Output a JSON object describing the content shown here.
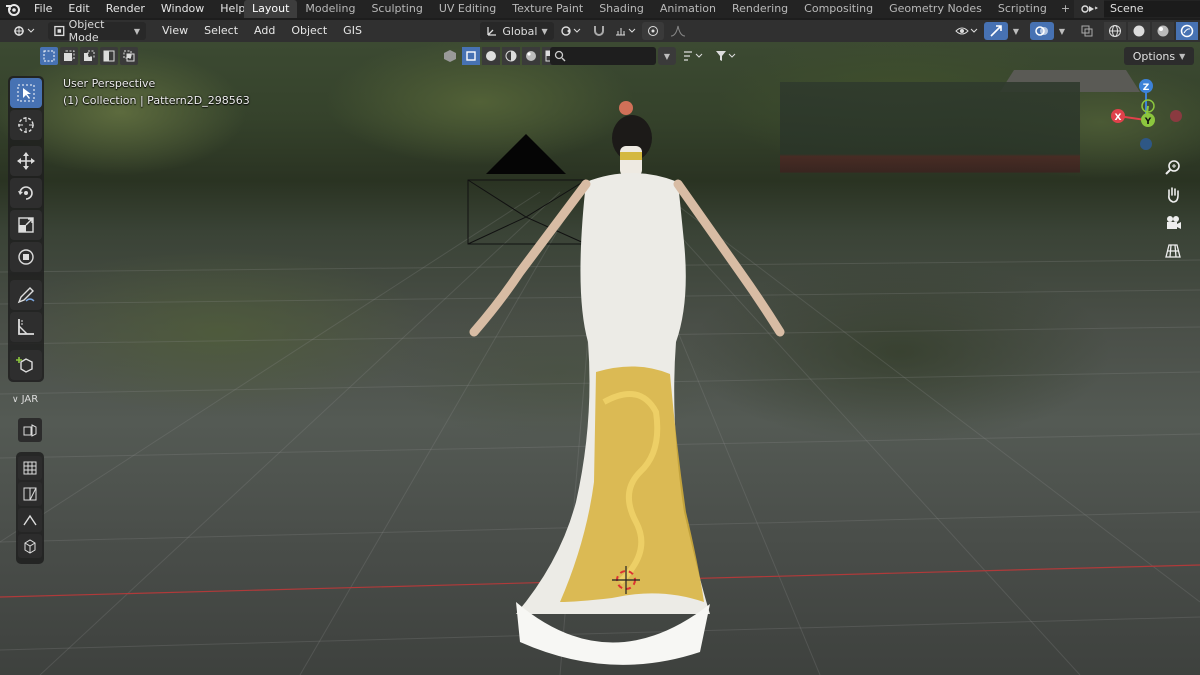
{
  "topbar": {
    "menus": [
      "File",
      "Edit",
      "Render",
      "Window",
      "Help"
    ],
    "workspaces": [
      "Layout",
      "Modeling",
      "Sculpting",
      "UV Editing",
      "Texture Paint",
      "Shading",
      "Animation",
      "Rendering",
      "Compositing",
      "Geometry Nodes",
      "Scripting"
    ],
    "active_workspace": "Layout",
    "add_symbol": "+",
    "scene_name": "Scene"
  },
  "viewport_header": {
    "mode": "Object Mode",
    "menus": [
      "View",
      "Select",
      "Add",
      "Object",
      "GIS"
    ],
    "transform_orientation": "Global"
  },
  "tool_settings": {
    "search_placeholder": "",
    "options_label": "Options"
  },
  "overlay": {
    "view_name": "User Perspective",
    "collection_info": "(1) Collection | Pattern2D_298563"
  },
  "toolbar": {
    "panel_label": "JAR"
  },
  "gizmo": {
    "axis_z": "Z",
    "axis_y": "Y",
    "axis_x": "X"
  },
  "colors": {
    "accent": "#4772b3",
    "axis_x": "#e0414b",
    "axis_y": "#8cc63e",
    "axis_z": "#3d82d8"
  }
}
